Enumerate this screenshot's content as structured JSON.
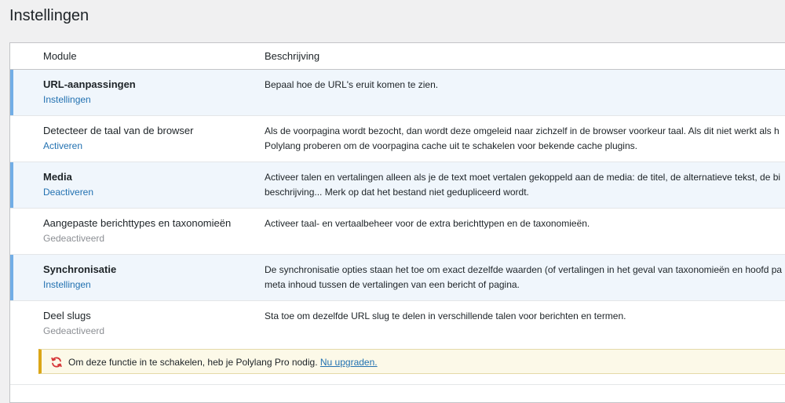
{
  "page": {
    "title": "Instellingen"
  },
  "table": {
    "headers": {
      "module": "Module",
      "description": "Beschrijving"
    },
    "rows": [
      {
        "name": "URL-aanpassingen",
        "action": "Instellingen",
        "active": true,
        "description_lines": [
          "Bepaal hoe de URL's eruit komen te zien."
        ]
      },
      {
        "name": "Detecteer de taal van de browser",
        "action": "Activeren",
        "active": false,
        "description_lines": [
          "Als de voorpagina wordt bezocht, dan wordt deze omgeleid naar zichzelf in de browser voorkeur taal. Als dit niet werkt als h",
          "Polylang proberen om de voorpagina cache uit te schakelen voor bekende cache plugins."
        ]
      },
      {
        "name": "Media",
        "action": "Deactiveren",
        "active": true,
        "description_lines": [
          "Activeer talen en vertalingen alleen als je de text moet vertalen gekoppeld aan de media: de titel, de alternatieve tekst, de bi",
          "beschrijving... Merk op dat het bestand niet gedupliceerd wordt."
        ]
      },
      {
        "name": "Aangepaste berichttypes en taxonomieën",
        "action": "Gedeactiveerd",
        "active": false,
        "description_lines": [
          "Activeer taal- en vertaalbeheer voor de extra berichttypen en de taxonomieën."
        ]
      },
      {
        "name": "Synchronisatie",
        "action": "Instellingen",
        "active": true,
        "description_lines": [
          "De synchronisatie opties staan het toe om exact dezelfde waarden (of vertalingen in het geval van taxonomieën en hoofd pa",
          "meta inhoud tussen de vertalingen van een bericht of pagina."
        ]
      },
      {
        "name": "Deel slugs",
        "action": "Gedeactiveerd",
        "active": false,
        "description_lines": [
          "Sta toe om dezelfde URL slug te delen in verschillende talen voor berichten en termen."
        ]
      }
    ]
  },
  "notice": {
    "text": "Om deze functie in te schakelen, heb je Polylang Pro nodig.",
    "link": "Nu upgraden.",
    "icon": "refresh-icon",
    "icon_color": "#d63638"
  },
  "colors": {
    "link": "#2271b1",
    "active_row_bg": "#f0f6fc",
    "active_row_border": "#72aee6",
    "notice_border": "#dba617",
    "muted": "#8c8f94"
  }
}
